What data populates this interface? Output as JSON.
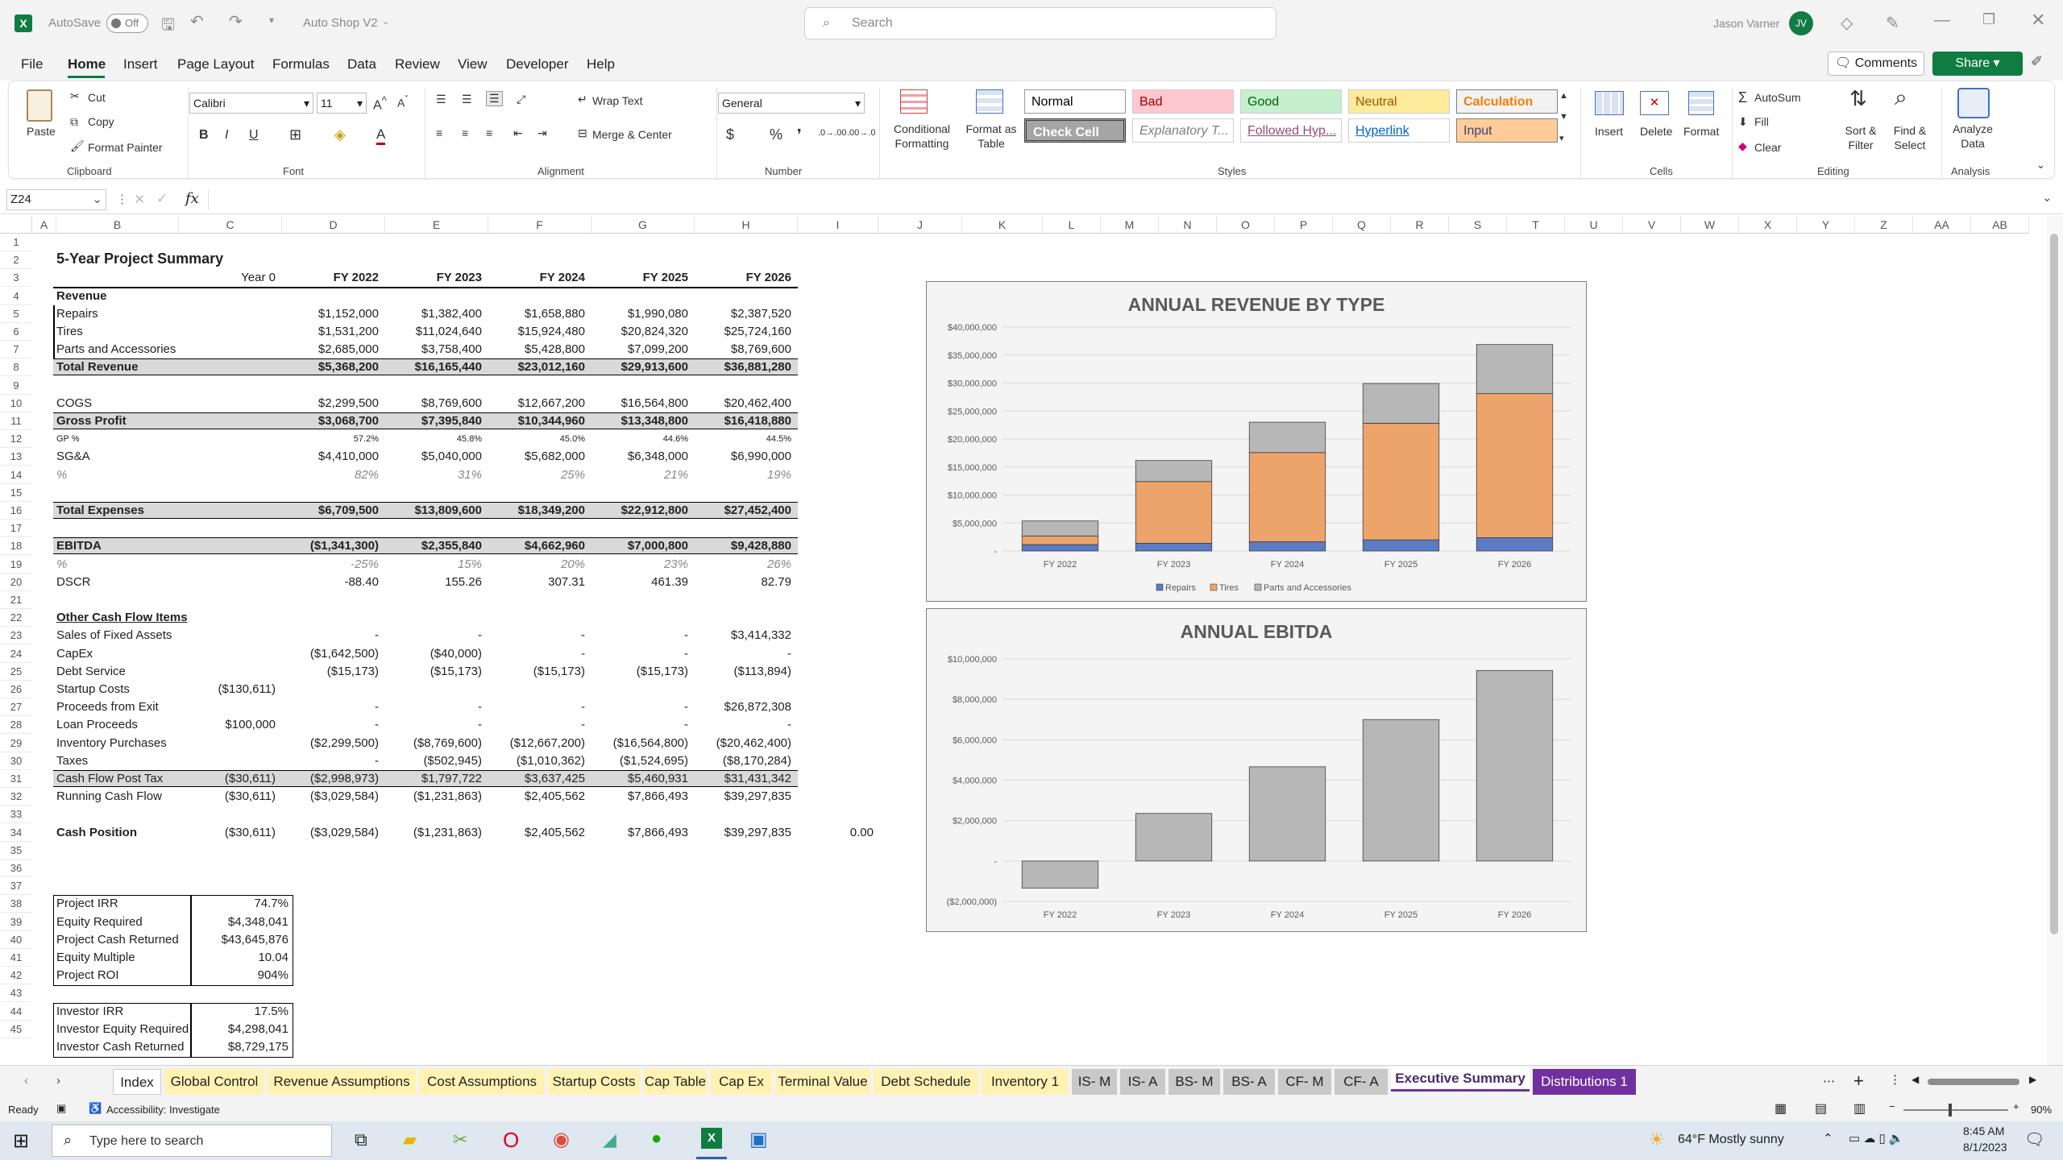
{
  "titlebar": {
    "autosave_label": "AutoSave",
    "autosave_state": "Off",
    "doc_title": "Auto Shop V2",
    "search_placeholder": "Search",
    "user_name": "Jason Varner",
    "user_initials": "JV"
  },
  "menu": [
    "File",
    "Home",
    "Insert",
    "Page Layout",
    "Formulas",
    "Data",
    "Review",
    "View",
    "Developer",
    "Help"
  ],
  "menu_active": "Home",
  "menu_right": {
    "comments": "Comments",
    "share": "Share"
  },
  "ribbon": {
    "clipboard": {
      "paste": "Paste",
      "cut": "Cut",
      "copy": "Copy",
      "format_painter": "Format Painter",
      "group": "Clipboard"
    },
    "font": {
      "name": "Calibri",
      "size": "11",
      "group": "Font"
    },
    "alignment": {
      "wrap": "Wrap Text",
      "merge": "Merge & Center",
      "group": "Alignment"
    },
    "number": {
      "format": "General",
      "group": "Number"
    },
    "styles": {
      "conditional": "Conditional Formatting",
      "format_table": "Format as Table",
      "group": "Styles",
      "cells": [
        {
          "label": "Normal",
          "bg": "#ffffff",
          "fg": "#000000"
        },
        {
          "label": "Bad",
          "bg": "#ffc7ce",
          "fg": "#9c0006"
        },
        {
          "label": "Good",
          "bg": "#c6efce",
          "fg": "#006100"
        },
        {
          "label": "Neutral",
          "bg": "#ffeb9c",
          "fg": "#9c5700"
        },
        {
          "label": "Calculation",
          "bg": "#f2f2f2",
          "fg": "#fa7d00"
        },
        {
          "label": "Check Cell",
          "bg": "#a5a5a5",
          "fg": "#ffffff"
        },
        {
          "label": "Explanatory T...",
          "bg": "#ffffff",
          "fg": "#7f7f7f"
        },
        {
          "label": "Followed Hyp...",
          "bg": "#ffffff",
          "fg": "#954f72"
        },
        {
          "label": "Hyperlink",
          "bg": "#ffffff",
          "fg": "#0563c1"
        },
        {
          "label": "Input",
          "bg": "#ffcc99",
          "fg": "#3f3f76"
        }
      ]
    },
    "cells": {
      "insert": "Insert",
      "delete": "Delete",
      "format": "Format",
      "group": "Cells"
    },
    "editing": {
      "autosum": "AutoSum",
      "fill": "Fill",
      "clear": "Clear",
      "sort": "Sort & Filter",
      "find": "Find & Select",
      "group": "Editing"
    },
    "analysis": {
      "analyze": "Analyze Data",
      "group": "Analysis"
    }
  },
  "formula_bar": {
    "name_box": "Z24",
    "formula": ""
  },
  "columns": [
    "A",
    "B",
    "C",
    "D",
    "E",
    "F",
    "G",
    "H",
    "I",
    "J",
    "K",
    "L",
    "M",
    "N",
    "O",
    "P",
    "Q",
    "R",
    "S",
    "T",
    "U",
    "V",
    "W",
    "X",
    "Y",
    "Z",
    "AA",
    "AB"
  ],
  "rows": [
    "1",
    "2",
    "3",
    "4",
    "5",
    "6",
    "7",
    "8",
    "9",
    "10",
    "11",
    "12",
    "13",
    "14",
    "15",
    "16",
    "17",
    "18",
    "19",
    "20",
    "21",
    "22",
    "23",
    "24",
    "25",
    "26",
    "27",
    "28",
    "29",
    "30",
    "31",
    "32",
    "33",
    "34",
    "35",
    "36",
    "37",
    "38",
    "39",
    "40",
    "41",
    "42",
    "43",
    "44",
    "45"
  ],
  "summary": {
    "title": "5-Year Project Summary",
    "col_headers": [
      "Year 0",
      "FY 2022",
      "FY 2023",
      "FY 2024",
      "FY 2025",
      "FY 2026"
    ],
    "revenue_label": "Revenue",
    "table_rows": [
      {
        "row": 5,
        "label": "Repairs",
        "vals": [
          "",
          "$1,152,000",
          "$1,382,400",
          "$1,658,880",
          "$1,990,080",
          "$2,387,520"
        ]
      },
      {
        "row": 6,
        "label": "Tires",
        "vals": [
          "",
          "$1,531,200",
          "$11,024,640",
          "$15,924,480",
          "$20,824,320",
          "$25,724,160"
        ]
      },
      {
        "row": 7,
        "label": "Parts and Accessories",
        "vals": [
          "",
          "$2,685,000",
          "$3,758,400",
          "$5,428,800",
          "$7,099,200",
          "$8,769,600"
        ]
      },
      {
        "row": 8,
        "label": "Total Revenue",
        "vals": [
          "",
          "$5,368,200",
          "$16,165,440",
          "$23,012,160",
          "$29,913,600",
          "$36,881,280"
        ],
        "bold": true,
        "shade": true
      },
      {
        "row": 10,
        "label": "COGS",
        "vals": [
          "",
          "$2,299,500",
          "$8,769,600",
          "$12,667,200",
          "$16,564,800",
          "$20,462,400"
        ]
      },
      {
        "row": 11,
        "label": "Gross Profit",
        "vals": [
          "",
          "$3,068,700",
          "$7,395,840",
          "$10,344,960",
          "$13,348,800",
          "$16,418,880"
        ],
        "bold": true,
        "shade": true
      },
      {
        "row": 12,
        "label": "GP %",
        "vals": [
          "",
          "57.2%",
          "45.8%",
          "45.0%",
          "44.6%",
          "44.5%"
        ],
        "small": true
      },
      {
        "row": 13,
        "label": "SG&A",
        "vals": [
          "",
          "$4,410,000",
          "$5,040,000",
          "$5,682,000",
          "$6,348,000",
          "$6,990,000"
        ]
      },
      {
        "row": 14,
        "label": "%",
        "vals": [
          "",
          "82%",
          "31%",
          "25%",
          "21%",
          "19%"
        ],
        "italic": true
      },
      {
        "row": 16,
        "label": "Total Expenses",
        "vals": [
          "",
          "$6,709,500",
          "$13,809,600",
          "$18,349,200",
          "$22,912,800",
          "$27,452,400"
        ],
        "bold": true,
        "shade": true
      },
      {
        "row": 18,
        "label": "EBITDA",
        "vals": [
          "",
          "($1,341,300)",
          "$2,355,840",
          "$4,662,960",
          "$7,000,800",
          "$9,428,880"
        ],
        "bold": true,
        "shade": true
      },
      {
        "row": 19,
        "label": "%",
        "vals": [
          "",
          "-25%",
          "15%",
          "20%",
          "23%",
          "26%"
        ],
        "italic": true
      },
      {
        "row": 20,
        "label": "DSCR",
        "vals": [
          "",
          "-88.40",
          "155.26",
          "307.31",
          "461.39",
          "82.79"
        ]
      },
      {
        "row": 22,
        "label": "Other Cash Flow Items",
        "vals": [
          "",
          "",
          "",
          "",
          "",
          ""
        ],
        "bold": true,
        "underline": true
      },
      {
        "row": 23,
        "label": "Sales of Fixed Assets",
        "vals": [
          "",
          "-",
          "-",
          "-",
          "-",
          "$3,414,332"
        ]
      },
      {
        "row": 24,
        "label": "CapEx",
        "vals": [
          "",
          "($1,642,500)",
          "($40,000)",
          "-",
          "-",
          "-"
        ]
      },
      {
        "row": 25,
        "label": "Debt Service",
        "vals": [
          "",
          "($15,173)",
          "($15,173)",
          "($15,173)",
          "($15,173)",
          "($113,894)"
        ]
      },
      {
        "row": 26,
        "label": "Startup Costs",
        "vals": [
          "($130,611)",
          "",
          "",
          "",
          "",
          ""
        ]
      },
      {
        "row": 27,
        "label": "Proceeds from Exit",
        "vals": [
          "",
          "-",
          "-",
          "-",
          "-",
          "$26,872,308"
        ]
      },
      {
        "row": 28,
        "label": "Loan Proceeds",
        "vals": [
          "$100,000",
          "-",
          "-",
          "-",
          "-",
          "-"
        ]
      },
      {
        "row": 29,
        "label": "Inventory Purchases",
        "vals": [
          "",
          "($2,299,500)",
          "($8,769,600)",
          "($12,667,200)",
          "($16,564,800)",
          "($20,462,400)"
        ]
      },
      {
        "row": 30,
        "label": "Taxes",
        "vals": [
          "",
          "-",
          "($502,945)",
          "($1,010,362)",
          "($1,524,695)",
          "($8,170,284)"
        ]
      },
      {
        "row": 31,
        "label": "Cash Flow Post Tax",
        "vals": [
          "($30,611)",
          "($2,998,973)",
          "$1,797,722",
          "$3,637,425",
          "$5,460,931",
          "$31,431,342"
        ],
        "shade": true
      },
      {
        "row": 32,
        "label": "Running Cash Flow",
        "vals": [
          "($30,611)",
          "($3,029,584)",
          "($1,231,863)",
          "$2,405,562",
          "$7,866,493",
          "$39,297,835"
        ]
      },
      {
        "row": 34,
        "label": "Cash Position",
        "vals": [
          "($30,611)",
          "($3,029,584)",
          "($1,231,863)",
          "$2,405,562",
          "$7,866,493",
          "$39,297,835"
        ],
        "bold_label": true
      }
    ],
    "i34": "0.00",
    "metrics": [
      {
        "row": 38,
        "label": "Project IRR",
        "value": "74.7%"
      },
      {
        "row": 39,
        "label": "Equity Required",
        "value": "$4,348,041"
      },
      {
        "row": 40,
        "label": "Project Cash Returned",
        "value": "$43,645,876"
      },
      {
        "row": 41,
        "label": "Equity Multiple",
        "value": "10.04"
      },
      {
        "row": 42,
        "label": "Project ROI",
        "value": "904%"
      }
    ],
    "investor": [
      {
        "row": 44,
        "label": "Investor IRR",
        "value": "17.5%"
      },
      {
        "row": 45,
        "label": "Investor Equity Required",
        "value": "$4,298,041"
      },
      {
        "row": 46,
        "label": "Investor Cash Returned",
        "value": "$8,729,175"
      }
    ]
  },
  "chart_data": [
    {
      "type": "bar",
      "stacked": true,
      "title": "ANNUAL REVENUE BY TYPE",
      "categories": [
        "FY 2022",
        "FY 2023",
        "FY 2024",
        "FY 2025",
        "FY 2026"
      ],
      "series": [
        {
          "name": "Repairs",
          "values": [
            1152000,
            1382400,
            1658880,
            1990080,
            2387520
          ],
          "color": "#5b7bc4"
        },
        {
          "name": "Tires",
          "values": [
            1531200,
            11024640,
            15924480,
            20824320,
            25724160
          ],
          "color": "#eda46a"
        },
        {
          "name": "Parts and Accessories",
          "values": [
            2685000,
            3758400,
            5428800,
            7099200,
            8769600
          ],
          "color": "#b7b7b7"
        }
      ],
      "ylim": [
        0,
        40000000
      ],
      "yticks": [
        "-",
        "$5,000,000",
        "$10,000,000",
        "$15,000,000",
        "$20,000,000",
        "$25,000,000",
        "$30,000,000",
        "$35,000,000",
        "$40,000,000"
      ],
      "legend": "bottom",
      "grid": true
    },
    {
      "type": "bar",
      "title": "ANNUAL EBITDA",
      "categories": [
        "FY 2022",
        "FY 2023",
        "FY 2024",
        "FY 2025",
        "FY 2026"
      ],
      "values": [
        -1341300,
        2355840,
        4662960,
        7000800,
        9428880
      ],
      "color": "#b7b7b7",
      "ylim": [
        -2000000,
        10000000
      ],
      "yticks": [
        "($2,000,000)",
        "-",
        "$2,000,000",
        "$4,000,000",
        "$6,000,000",
        "$8,000,000",
        "$10,000,000"
      ],
      "grid": true
    }
  ],
  "sheet_tabs": [
    {
      "label": "Index",
      "color": "#ffffff"
    },
    {
      "label": "Global Control",
      "color": "#fff2b3"
    },
    {
      "label": "Revenue Assumptions",
      "color": "#fff2b3"
    },
    {
      "label": "Cost Assumptions",
      "color": "#fff2b3"
    },
    {
      "label": "Startup Costs",
      "color": "#fff2b3"
    },
    {
      "label": "Cap Table",
      "color": "#fff2b3"
    },
    {
      "label": "Cap Ex",
      "color": "#fff2b3"
    },
    {
      "label": "Terminal Value",
      "color": "#fff2b3"
    },
    {
      "label": "Debt Schedule",
      "color": "#fff2b3"
    },
    {
      "label": "Inventory 1",
      "color": "#fff2b3"
    },
    {
      "label": "IS- M",
      "color": "#c9c9c9"
    },
    {
      "label": "IS- A",
      "color": "#c9c9c9"
    },
    {
      "label": "BS- M",
      "color": "#c9c9c9"
    },
    {
      "label": "BS- A",
      "color": "#c9c9c9"
    },
    {
      "label": "CF- M",
      "color": "#c9c9c9"
    },
    {
      "label": "CF- A",
      "color": "#c9c9c9"
    },
    {
      "label": "Executive Summary",
      "color": "#e8d9f3"
    },
    {
      "label": "Distributions 1",
      "color": "#7030a0"
    }
  ],
  "status": {
    "ready": "Ready",
    "accessibility": "Accessibility: Investigate",
    "zoom": "90%"
  },
  "taskbar": {
    "search_placeholder": "Type here to search",
    "weather": "64°F  Mostly sunny",
    "time": "8:45 AM",
    "date": "8/1/2023"
  }
}
